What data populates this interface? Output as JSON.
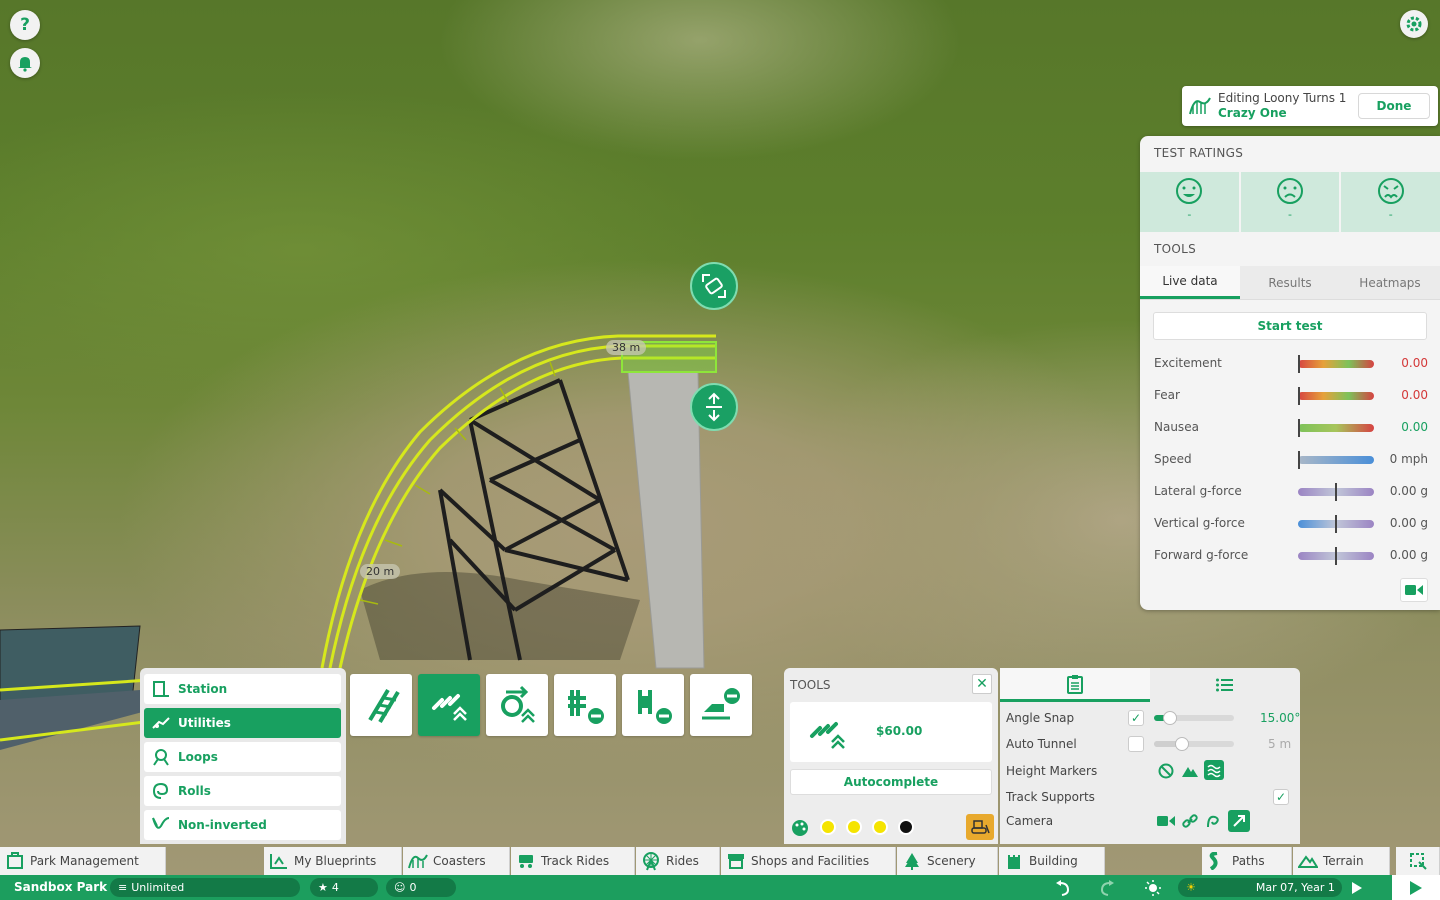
{
  "world": {
    "height_label_top": "38 m",
    "height_label_bottom": "20 m"
  },
  "header": {
    "editing_label": "Editing Loony Turns 1",
    "ride_name": "Crazy One",
    "done_label": "Done"
  },
  "test_ratings": {
    "title": "TEST RATINGS",
    "ratings": [
      {
        "icon": "happy-face-icon",
        "value": "-"
      },
      {
        "icon": "scared-face-icon",
        "value": "-"
      },
      {
        "icon": "nauseous-face-icon",
        "value": "-"
      }
    ]
  },
  "tools_section": {
    "title": "TOOLS",
    "tabs": [
      "Live data",
      "Results",
      "Heatmaps"
    ],
    "active_tab": "Live data",
    "start_test_label": "Start test",
    "stats": [
      {
        "label": "Excitement",
        "value": "0.00",
        "level": 0
      },
      {
        "label": "Fear",
        "value": "0.00",
        "level": 0
      },
      {
        "label": "Nausea",
        "value": "0.00",
        "level": 0
      },
      {
        "label": "Speed",
        "value": "0 mph",
        "level": 0
      },
      {
        "label": "Lateral g-force",
        "value": "0.00 g",
        "level": 0.5
      },
      {
        "label": "Vertical g-force",
        "value": "0.00 g",
        "level": 0.5
      },
      {
        "label": "Forward g-force",
        "value": "0.00 g",
        "level": 0.5
      }
    ]
  },
  "categories": {
    "items": [
      {
        "label": "Station",
        "icon": "station-icon"
      },
      {
        "label": "Utilities",
        "icon": "utilities-icon",
        "active": true
      },
      {
        "label": "Loops",
        "icon": "loop-icon"
      },
      {
        "label": "Rolls",
        "icon": "roll-icon"
      },
      {
        "label": "Non-inverted",
        "icon": "non-inverted-icon"
      }
    ]
  },
  "pieces": [
    "track-piece-icon",
    "chain-lift-icon",
    "booster-icon",
    "brake-remove-icon",
    "block-brake-remove-icon",
    "launch-remove-icon"
  ],
  "tools_card": {
    "title": "TOOLS",
    "chain_price": "$60.00",
    "autocomplete_label": "Autocomplete",
    "swatch_colors": [
      "#f5e400",
      "#f5e400",
      "#f5e400",
      "#111111"
    ]
  },
  "options": {
    "angle_snap": {
      "label": "Angle Snap",
      "checked": true,
      "value": "15.00°",
      "level": 0.2
    },
    "auto_tunnel": {
      "label": "Auto Tunnel",
      "checked": false,
      "value": "5 m",
      "level": 0.35
    },
    "height_markers": {
      "label": "Height Markers"
    },
    "track_supports": {
      "label": "Track Supports",
      "checked": true
    },
    "camera": {
      "label": "Camera"
    }
  },
  "toolbar": {
    "park_management": "Park Management",
    "my_blueprints": "My Blueprints",
    "coasters": "Coasters",
    "track_rides": "Track Rides",
    "rides": "Rides",
    "shops": "Shops and Facilities",
    "scenery": "Scenery",
    "building": "Building",
    "paths": "Paths",
    "terrain": "Terrain"
  },
  "status": {
    "park_name": "Sandbox Park",
    "money": "Unlimited",
    "rating": "4",
    "guests": "0",
    "date": "Mar 07, Year 1"
  },
  "colors": {
    "accent": "#18a060",
    "track": "#d6e81c"
  }
}
